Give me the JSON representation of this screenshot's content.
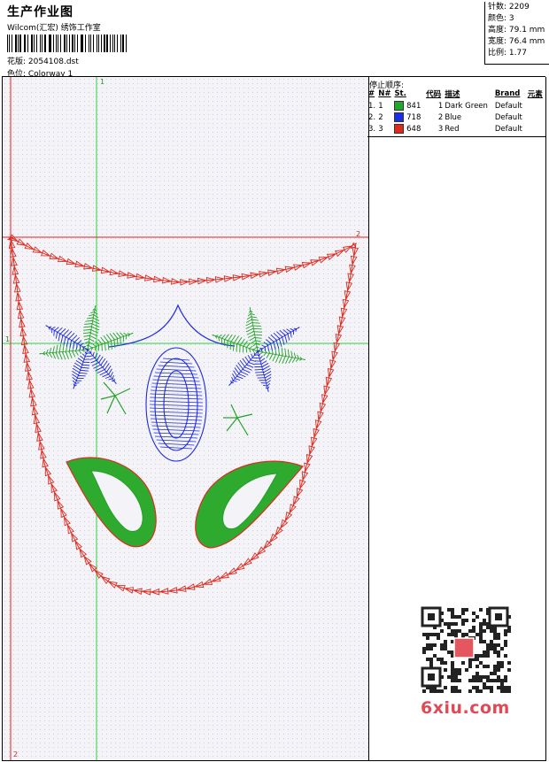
{
  "header": {
    "title": "生产作业图",
    "company": "Wilcom(汇宏) 绣饰工作室",
    "design_label": "花版: 2054108.dst",
    "colorway_label": "色位: Colorway 1"
  },
  "stats": {
    "stitches": "针数: 2209",
    "colors": "颜色: 3",
    "height": "高度: 79.1 mm",
    "width": "宽度: 76.4 mm",
    "scale": "比例: 1.77"
  },
  "stops": {
    "title": "停止顺序:",
    "headers": [
      "#",
      "N#",
      "St.",
      "代码",
      "描述",
      "Brand",
      "元素"
    ],
    "rows": [
      {
        "num": "1.",
        "n": "1",
        "st": "841",
        "code": "1",
        "desc": "Dark Green",
        "brand": "Default",
        "color": "#21a82b"
      },
      {
        "num": "2.",
        "n": "2",
        "st": "718",
        "code": "2",
        "desc": "Blue",
        "brand": "Default",
        "color": "#1b2fe6"
      },
      {
        "num": "3.",
        "n": "3",
        "st": "648",
        "code": "3",
        "desc": "Red",
        "brand": "Default",
        "color": "#e0281c"
      }
    ]
  },
  "markers": {
    "top_green": "1",
    "left_green": "1",
    "red_right": "2",
    "red_bottom": "2"
  },
  "watermark": "6xiu.com",
  "colors": {
    "green": "#22a126",
    "blue": "#1d2ae0",
    "red": "#e02a20",
    "guide_green": "#27d23a",
    "guide_red": "#e81d1d"
  }
}
